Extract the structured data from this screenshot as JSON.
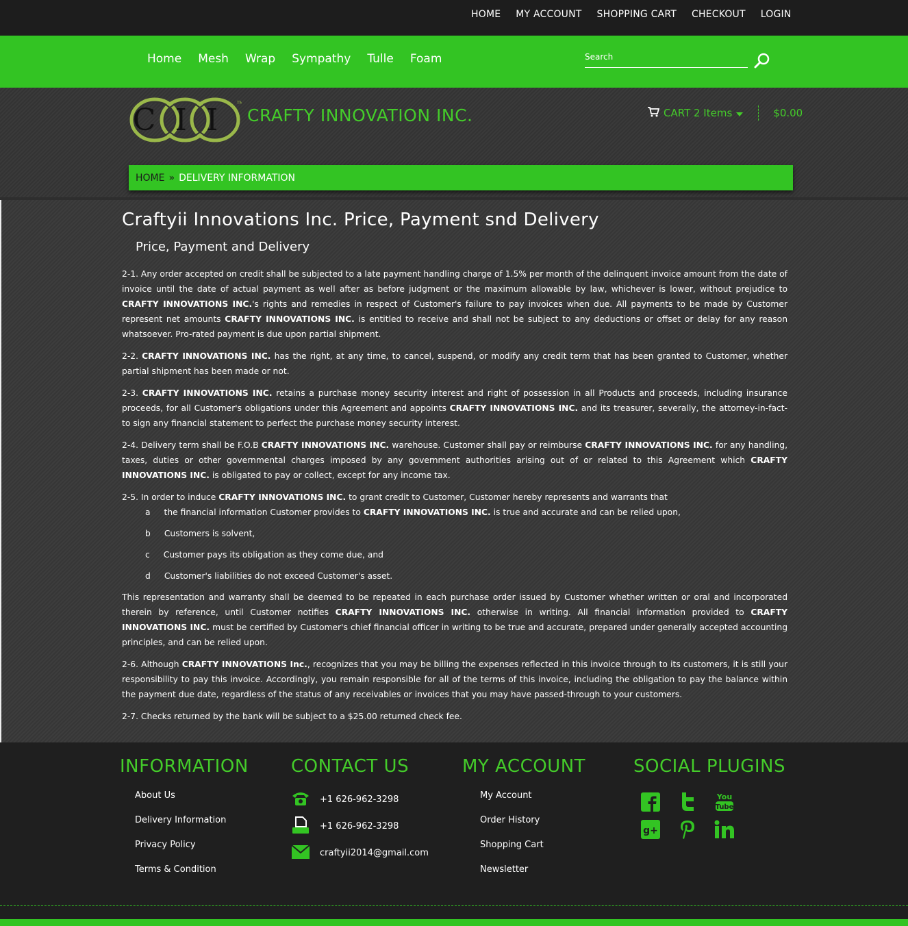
{
  "topbar": {
    "links": [
      "HOME",
      "MY ACCOUNT",
      "SHOPPING CART",
      "CHECKOUT",
      "LOGIN"
    ]
  },
  "nav": {
    "menu": [
      "Home",
      "Mesh",
      "Wrap",
      "Sympathy",
      "Tulle",
      "Foam"
    ],
    "search_placeholder": "Search"
  },
  "header": {
    "logo_text": "CII",
    "brand": "CRAFTY INNOVATION INC.",
    "cart_label": "CART 2 Items",
    "cart_total": "$0.00"
  },
  "breadcrumb": {
    "home": "HOME",
    "separator": "»",
    "current": "DELIVERY INFORMATION"
  },
  "article": {
    "title": "Craftyii Innovations Inc. Price, Payment snd Delivery",
    "subtitle": "Price, Payment and Delivery",
    "company": "CRAFTY INNOVATIONS INC.",
    "p1a": "2-1. Any order accepted on credit shall be subjected to a late payment handling charge of 1.5% per month of the delinquent invoice amount from the date of invoice until the date of actual payment   as well after as before judgment   or the maximum allowable by law, whichever is lower, without prejudice to ",
    "p1b": "CRAFTY INNOVATIONS INC.",
    "p1c": "'s rights and remedies in respect of Customer's failure to pay invoices when due. All payments to be made by Customer represent net amounts ",
    "p1d": "CRAFTY INNOVATIONS INC.",
    "p1e": " is entitled to receive and shall not be subject to any deductions or offset or delay for any reason whatsoever. Pro-rated payment is due upon partial shipment.",
    "p2a": "2-2. ",
    "p2b": "CRAFTY INNOVATIONS INC.",
    "p2c": " has the right, at any time, to cancel, suspend, or modify any credit term that has been granted to Customer, whether partial shipment has been made or not.",
    "p3a": "2-3. ",
    "p3b": "CRAFTY INNOVATIONS INC.",
    "p3c": " retains a purchase money security interest and right of possession in all Products and proceeds, including insurance proceeds, for all Customer's obligations under this Agreement and appoints ",
    "p3d": "CRAFTY INNOVATIONS INC.",
    "p3e": " and its treasurer, severally, the attorney-in-fact- to sign any financial statement to perfect the purchase money security interest.",
    "p4a": "2-4. Delivery term shall be F.O.B ",
    "p4b": "CRAFTY INNOVATIONS INC.",
    "p4c": " warehouse. Customer shall pay or reimburse ",
    "p4d": "CRAFTY INNOVATIONS INC.",
    "p4e": " for any handling, taxes, duties or other governmental charges imposed by any government authorities arising out of or related to this Agreement which ",
    "p4f": "CRAFTY INNOVATIONS INC.",
    "p4g": " is obligated to pay or collect, except for any income tax.",
    "p5a": "2-5. In order to induce ",
    "p5b": "CRAFTY INNOVATIONS INC.",
    "p5c": " to grant credit to Customer, Customer hereby represents and warrants that",
    "sa_letter": "a",
    "sa_text1": "the financial information Customer provides to ",
    "sa_text2": "CRAFTY INNOVATIONS INC.",
    "sa_text3": " is true and accurate and can be relied upon,",
    "sb_letter": "b",
    "sb_text": "Customers is solvent,",
    "sc_letter": "c",
    "sc_text": "Customer pays its obligation as they come due, and",
    "sd_letter": "d",
    "sd_text": "Customer's liabilities do not exceed Customer's asset.",
    "p6a": "This representation and warranty shall be deemed to be repeated in each purchase order issued by Customer   whether written or oral   and incorporated therein by reference, until Customer notifies ",
    "p6b": "CRAFTY INNOVATIONS INC.",
    "p6c": " otherwise in writing. All financial information provided to ",
    "p6d": "CRAFTY INNOVATIONS INC.",
    "p6e": " must be certified by Customer's chief financial officer in writing to be true and accurate, prepared under generally accepted accounting principles, and can be relied upon.",
    "p7a": "2-6. Although ",
    "p7b": "CRAFTY INNOVATIONS Inc.",
    "p7c": ", recognizes that you may be billing the expenses reflected in this invoice through to its customers, it is still your responsibility to pay this invoice. Accordingly, you remain responsible for all of the terms of this invoice, including the obligation to pay the balance within the payment due date, regardless of the status of any receivables or invoices that you may have passed-through to your customers.",
    "p8": "2-7. Checks returned by the bank will be subject to a $25.00 returned check fee."
  },
  "footer": {
    "info_title": "INFORMATION",
    "info_links": [
      "About Us",
      "Delivery Information",
      "Privacy Policy",
      "Terms & Condition"
    ],
    "contact_title": "CONTACT US",
    "phone": "+1 626-962-3298",
    "fax": "+1 626-962-3298",
    "email": "craftyii2014@gmail.com",
    "account_title": "MY ACCOUNT",
    "account_links": [
      "My Account",
      "Order History",
      "Shopping Cart",
      "Newsletter"
    ],
    "social_title": "SOCIAL PLUGINS",
    "youtube_top": "You",
    "youtube_bottom": "Tube"
  },
  "colors": {
    "accent": "#33c423",
    "accent_text": "#44cc2a",
    "dark": "#1d1d1d"
  }
}
